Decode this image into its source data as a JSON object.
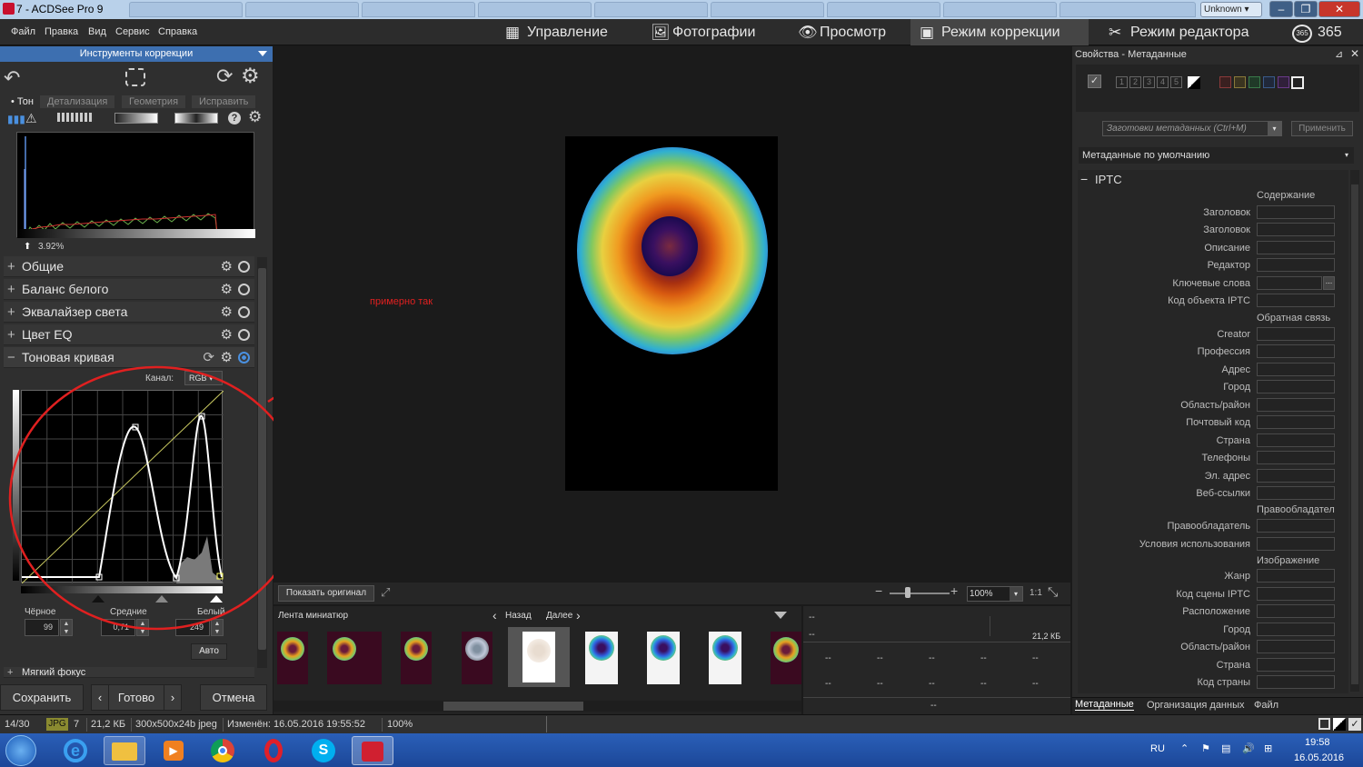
{
  "window": {
    "title": "7 - ACDSee Pro 9",
    "unknown_label": "Unknown"
  },
  "menu": [
    "Файл",
    "Правка",
    "Вид",
    "Сервис",
    "Справка"
  ],
  "modes": [
    {
      "label": "Управление",
      "icon": "grid-icon"
    },
    {
      "label": "Фотографии",
      "icon": "photos-icon"
    },
    {
      "label": "Просмотр",
      "icon": "eye-icon"
    },
    {
      "label": "Режим коррекции",
      "icon": "develop-icon"
    },
    {
      "label": "Режим редактора",
      "icon": "edit-tools-icon"
    },
    {
      "label": "365",
      "icon": "cloud-365-icon"
    }
  ],
  "left_panel": {
    "header": "Инструменты коррекции",
    "tabs": [
      "Тон",
      "Детализация",
      "Геометрия",
      "Исправить"
    ],
    "histogram_value": "3.92%",
    "sections": [
      "Общие",
      "Баланс белого",
      "Эквалайзер света",
      "Цвет EQ"
    ],
    "tone_curve": {
      "title": "Тоновая кривая",
      "channel_label": "Канал:",
      "channel_value": "RGB",
      "black_label": "Чёрное",
      "black_value": "99",
      "mid_label": "Средние",
      "mid_value": "0,71",
      "white_label": "Белый",
      "white_value": "249",
      "auto_button": "Авто"
    },
    "next_section": "Мягкий фокус",
    "save_button": "Сохранить",
    "done_button": "Готово",
    "cancel_button": "Отмена"
  },
  "center": {
    "annotation_text": "примерно так",
    "show_original": "Показать оригинал",
    "zoom_value": "100%",
    "ratio_label": "1:1"
  },
  "filmstrip": {
    "title": "Лента миниатюр",
    "back": "Назад",
    "next": "Далее"
  },
  "info_panel": {
    "row1": "--",
    "row2": "--",
    "size": "21,2 КБ",
    "cells": [
      "--",
      "--",
      "--",
      "--",
      "--"
    ],
    "footer": "--"
  },
  "right_panel": {
    "header": "Свойства - Метаданные",
    "rating_numbers": [
      "1",
      "2",
      "3",
      "4",
      "5"
    ],
    "preset_placeholder": "Заготовки метаданных (Ctrl+M)",
    "apply_button": "Применить",
    "default_metadata": "Метаданные по умолчанию",
    "iptc_title": "IPTC",
    "groups": [
      {
        "title": "Содержание",
        "fields": [
          "Заголовок",
          "Заголовок",
          "Описание",
          "Редактор",
          "Ключевые слова",
          "Код объекта IPTC"
        ]
      },
      {
        "title": "Обратная связь",
        "fields": [
          "Creator",
          "Профессия",
          "Адрес",
          "Город",
          "Область/район",
          "Почтовый код",
          "Страна",
          "Телефоны",
          "Эл. адрес",
          "Веб-ссылки"
        ]
      },
      {
        "title": "Правообладател",
        "fields": [
          "Правообладатель",
          "Условия использования"
        ]
      },
      {
        "title": "Изображение",
        "fields": [
          "Жанр",
          "Код сцены IPTC",
          "Расположение",
          "Город",
          "Область/район",
          "Страна",
          "Код страны"
        ]
      }
    ],
    "bottom_tabs": [
      "Метаданные",
      "Организация данных",
      "Файл"
    ]
  },
  "statusbar": {
    "index": "14/30",
    "format": "JPG",
    "number": "7",
    "size": "21,2 КБ",
    "dims": "300x500x24b jpeg",
    "modified": "Изменён: 16.05.2016 19:55:52",
    "zoom": "100%"
  },
  "taskbar": {
    "lang": "RU",
    "time": "19:58",
    "date": "16.05.2016"
  },
  "colors": {
    "accent": "#3d6fb0",
    "annotation": "#e02020"
  }
}
